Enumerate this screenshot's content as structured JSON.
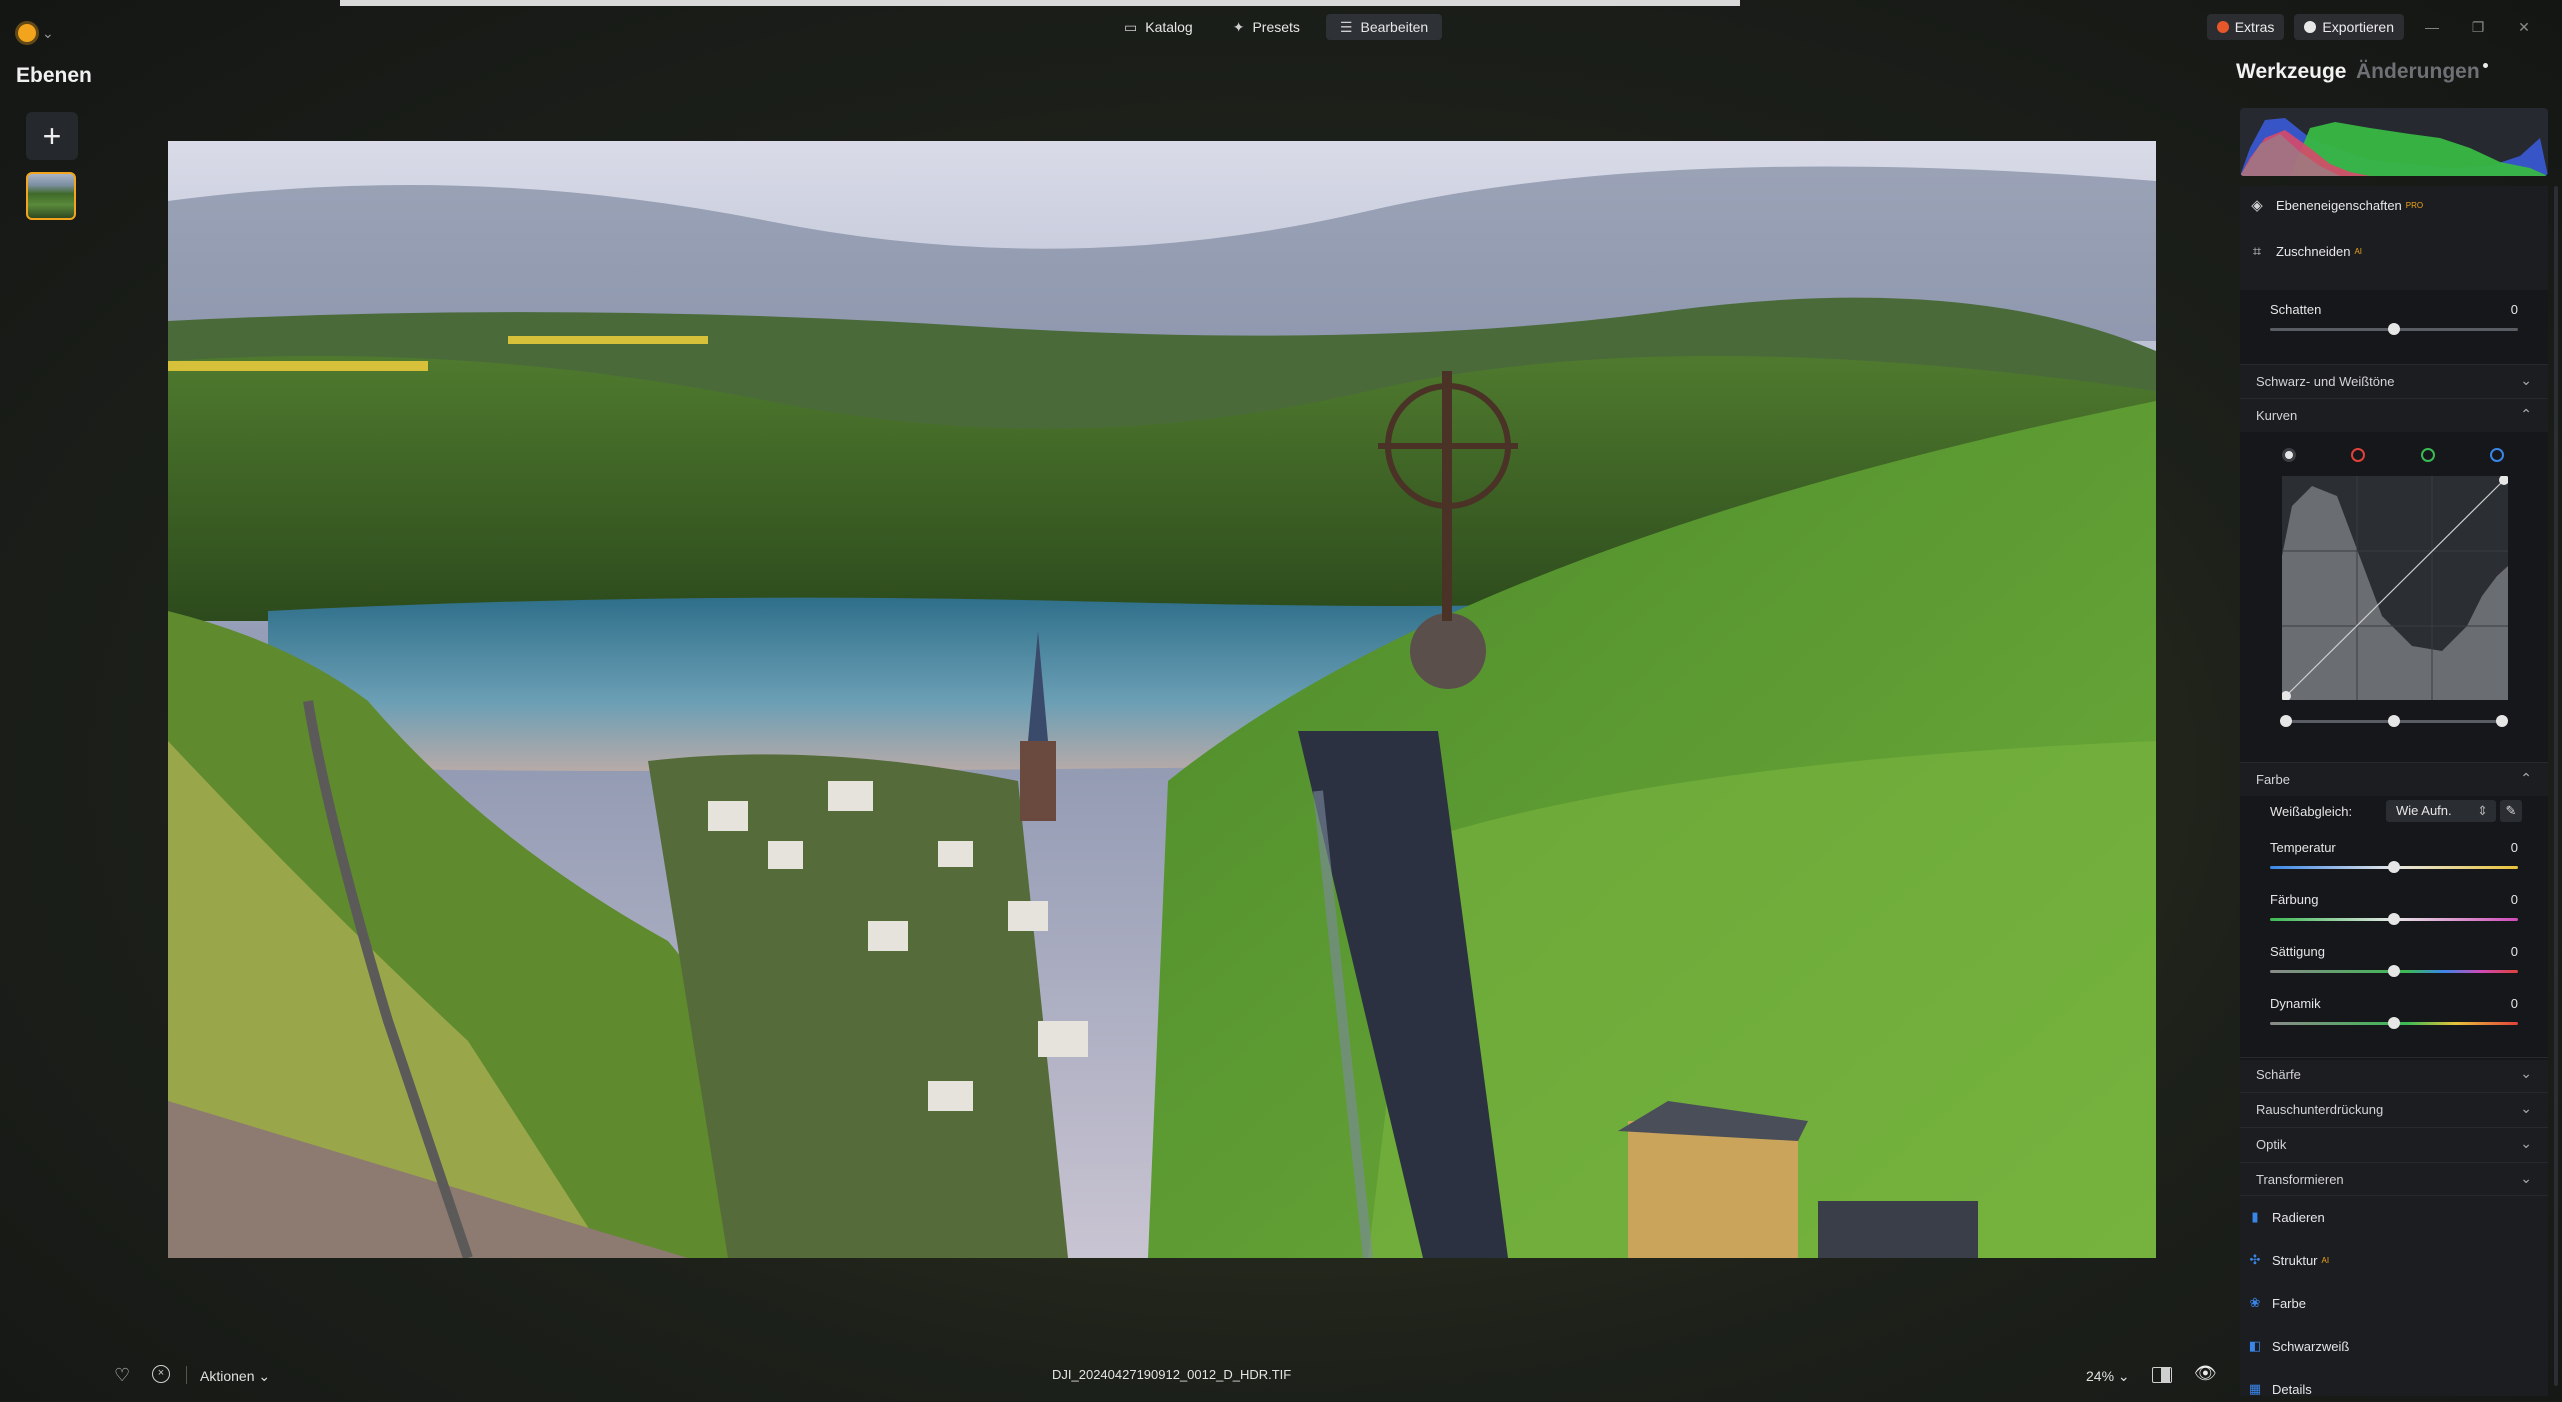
{
  "topbar": {
    "modes": [
      {
        "label": "Katalog",
        "icon": "book-icon"
      },
      {
        "label": "Presets",
        "icon": "sparkle-icon"
      },
      {
        "label": "Bearbeiten",
        "icon": "sliders-icon"
      }
    ],
    "extras_label": "Extras",
    "export_label": "Exportieren",
    "window_controls": [
      "—",
      "❐",
      "✕"
    ]
  },
  "left_panel": {
    "title": "Ebenen",
    "add_symbol": "+"
  },
  "photo": {
    "filename": "DJI_20240427190912_0012_D_HDR.TIF"
  },
  "bottombar": {
    "actions_label": "Aktionen",
    "zoom_label": "24%"
  },
  "right_panel": {
    "title": "Werkzeuge",
    "title2": "Änderungen",
    "tools_top": [
      {
        "label": "Ebeneneigenschaften",
        "badge": "PRO",
        "icon": "layers-icon"
      },
      {
        "label": "Zuschneiden",
        "badge": "AI",
        "icon": "crop-icon"
      }
    ],
    "schatten": {
      "label": "Schatten",
      "value": "0",
      "level": 0.5
    },
    "sections": {
      "black_white": "Schwarz- und Weißtöne",
      "kurven": "Kurven",
      "farbe": "Farbe",
      "schaerfe": "Schärfe",
      "rausch": "Rauschunterdrückung",
      "optik": "Optik",
      "transformieren": "Transformieren"
    },
    "curve_channels": [
      "white",
      "red",
      "green",
      "blue"
    ],
    "colors": {
      "accent": "#f2a51c",
      "red": "#e0413a",
      "green": "#3cba54",
      "blue": "#3a86e8"
    },
    "farbe": {
      "wb_label": "Weißabgleich:",
      "wb_value": "Wie Aufn.",
      "sliders": [
        {
          "label": "Temperatur",
          "value": "0",
          "level": 0.5
        },
        {
          "label": "Färbung",
          "value": "0",
          "level": 0.5
        },
        {
          "label": "Sättigung",
          "value": "0",
          "level": 0.5
        },
        {
          "label": "Dynamik",
          "value": "0",
          "level": 0.5
        }
      ]
    },
    "tool_list": [
      {
        "label": "Radieren",
        "icon": "eraser-icon"
      },
      {
        "label": "Struktur",
        "badge": "AI",
        "icon": "structure-icon"
      },
      {
        "label": "Farbe",
        "icon": "color-icon"
      },
      {
        "label": "Schwarzweiß",
        "icon": "bw-icon"
      },
      {
        "label": "Details",
        "icon": "details-icon"
      }
    ]
  }
}
